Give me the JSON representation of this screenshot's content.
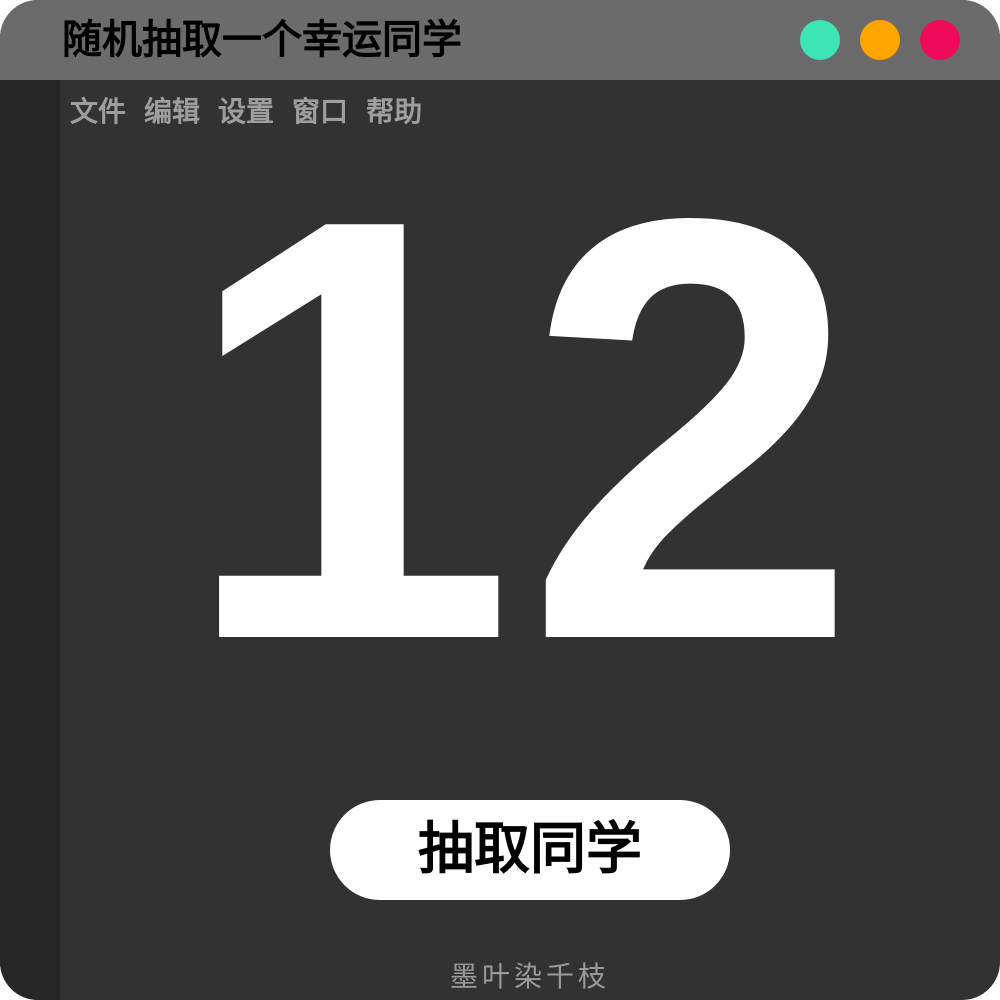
{
  "window": {
    "title": "随机抽取一个幸运同学",
    "controls": [
      {
        "name": "green",
        "color": "#3ee3b6"
      },
      {
        "name": "orange",
        "color": "#ffa500"
      },
      {
        "name": "red",
        "color": "#f00a5a"
      }
    ]
  },
  "menu": {
    "items": [
      "文件",
      "编辑",
      "设置",
      "窗口",
      "帮助"
    ]
  },
  "main": {
    "number": "12",
    "draw_button_label": "抽取同学"
  },
  "footer": {
    "signature": "墨叶染千枝"
  },
  "colors": {
    "window_bg": "#323232",
    "titlebar_bg": "#6b6b6b",
    "sidebar_bg": "#262626",
    "menu_text": "#9e9e9e",
    "number_text": "#ffffff",
    "button_bg": "#ffffff"
  }
}
